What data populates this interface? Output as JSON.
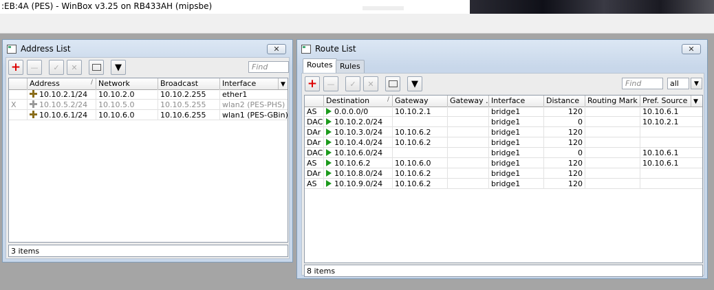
{
  "app": {
    "title": ":EB:4A (PES) - WinBox v3.25 on RB433AH (mipsbe)"
  },
  "address_list": {
    "title": "Address List",
    "find_placeholder": "Find",
    "columns": [
      "Address",
      "Network",
      "Broadcast",
      "Interface"
    ],
    "rows": [
      {
        "flag": "",
        "address": "10.10.2.1/24",
        "network": "10.10.2.0",
        "broadcast": "10.10.2.255",
        "interface": "ether1"
      },
      {
        "flag": "X",
        "address": "10.10.5.2/24",
        "network": "10.10.5.0",
        "broadcast": "10.10.5.255",
        "interface": "wlan2 (PES-PHS)"
      },
      {
        "flag": "",
        "address": "10.10.6.1/24",
        "network": "10.10.6.0",
        "broadcast": "10.10.6.255",
        "interface": "wlan1 (PES-GBin)"
      }
    ],
    "status": "3 items"
  },
  "route_list": {
    "title": "Route List",
    "tabs": [
      "Routes",
      "Rules"
    ],
    "find_placeholder": "Find",
    "filter_value": "all",
    "columns": [
      "Destination",
      "Gateway",
      "Gateway ...",
      "Interface",
      "Distance",
      "Routing Mark",
      "Pref. Source"
    ],
    "rows": [
      {
        "flags": "AS",
        "destination": "0.0.0.0/0",
        "gateway": "10.10.2.1",
        "interface": "bridge1",
        "distance": "120",
        "pref_source": "10.10.6.1"
      },
      {
        "flags": "DAC",
        "destination": "10.10.2.0/24",
        "gateway": "",
        "interface": "bridge1",
        "distance": "0",
        "pref_source": "10.10.2.1"
      },
      {
        "flags": "DAr",
        "destination": "10.10.3.0/24",
        "gateway": "10.10.6.2",
        "interface": "bridge1",
        "distance": "120",
        "pref_source": ""
      },
      {
        "flags": "DAr",
        "destination": "10.10.4.0/24",
        "gateway": "10.10.6.2",
        "interface": "bridge1",
        "distance": "120",
        "pref_source": ""
      },
      {
        "flags": "DAC",
        "destination": "10.10.6.0/24",
        "gateway": "",
        "interface": "bridge1",
        "distance": "0",
        "pref_source": "10.10.6.1"
      },
      {
        "flags": "AS",
        "destination": "10.10.6.2",
        "gateway": "10.10.6.0",
        "interface": "bridge1",
        "distance": "120",
        "pref_source": "10.10.6.1"
      },
      {
        "flags": "DAr",
        "destination": "10.10.8.0/24",
        "gateway": "10.10.6.2",
        "interface": "bridge1",
        "distance": "120",
        "pref_source": ""
      },
      {
        "flags": "AS",
        "destination": "10.10.9.0/24",
        "gateway": "10.10.6.2",
        "interface": "bridge1",
        "distance": "120",
        "pref_source": ""
      }
    ],
    "status": "8 items"
  },
  "colors": {
    "desktop": "#a5a5a5",
    "window_frame": "#c8d7ea",
    "add_icon": "#dd0000",
    "route_flag": "#1c9a1c"
  }
}
